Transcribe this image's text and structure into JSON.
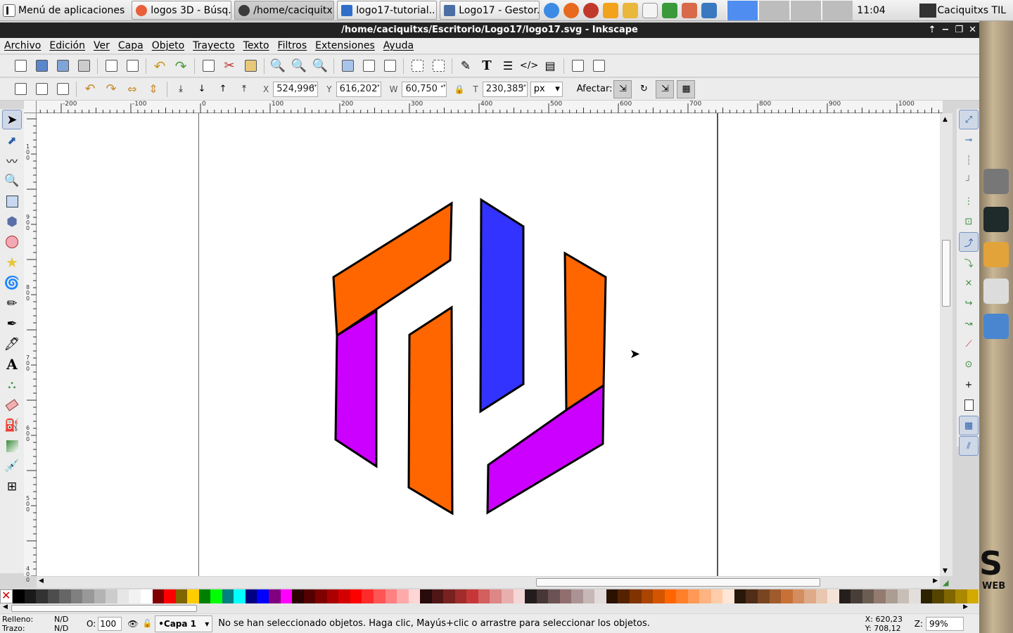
{
  "taskbar": {
    "app_menu": "Menú de aplicaciones",
    "tasks": [
      {
        "label": "logos 3D - Búsq...",
        "color": "#e8603a"
      },
      {
        "label": "/home/caciquitx...",
        "color": "#3a3a3a"
      },
      {
        "label": "logo17-tutorial....",
        "color": "#2f6fc9"
      },
      {
        "label": "Logo17 - Gestor...",
        "color": "#4a6fa5"
      }
    ],
    "launchers": [
      {
        "name": "chromium-icon",
        "color": "#3c8be4"
      },
      {
        "name": "firefox-icon",
        "color": "#e86a1e"
      },
      {
        "name": "pidgin-icon",
        "color": "#c0392b"
      },
      {
        "name": "hand-icon",
        "color": "#f2a21b"
      },
      {
        "name": "text-editor-icon",
        "color": "#e9b73c"
      },
      {
        "name": "document-icon",
        "color": "#f4f4f4"
      },
      {
        "name": "spreadsheet-icon",
        "color": "#3a9a3a"
      },
      {
        "name": "pdf-icon",
        "color": "#d86a4a"
      },
      {
        "name": "presentation-icon",
        "color": "#3a78c0"
      }
    ],
    "clock": "11:04",
    "user": "Caciquitxs TIL"
  },
  "window": {
    "title": "/home/caciquitxs/Escritorio/Logo17/logo17.svg - Inkscape"
  },
  "menu": [
    "Archivo",
    "Edición",
    "Ver",
    "Capa",
    "Objeto",
    "Trayecto",
    "Texto",
    "Filtros",
    "Extensiones",
    "Ayuda"
  ],
  "controls": {
    "x_label": "X",
    "x_value": "524,996",
    "y_label": "Y",
    "y_value": "616,202",
    "w_label": "W",
    "w_value": "60,750",
    "h_label": "T",
    "h_value": "230,385",
    "unit": "px",
    "afectar": "Afectar:"
  },
  "ruler": {
    "h_labels": [
      "-200",
      "-100",
      "0",
      "100",
      "200",
      "300",
      "400",
      "500",
      "600",
      "700",
      "800",
      "900",
      "1000"
    ],
    "v_labels": [
      "100",
      "900",
      "800",
      "700",
      "600",
      "500",
      "400"
    ]
  },
  "artwork": {
    "orange": "#ff6600",
    "purple": "#cc00ff",
    "blue": "#3333ff",
    "stroke": "#000000"
  },
  "palette": [
    "#000000",
    "#1a1a1a",
    "#333333",
    "#4d4d4d",
    "#666666",
    "#808080",
    "#999999",
    "#b3b3b3",
    "#cccccc",
    "#e6e6e6",
    "#f2f2f2",
    "#ffffff",
    "#800000",
    "#ff0000",
    "#806600",
    "#ffcc00",
    "#008000",
    "#00ff00",
    "#008080",
    "#00ffff",
    "#000080",
    "#0000ff",
    "#800080",
    "#ff00ff",
    "#2b0000",
    "#550000",
    "#800000",
    "#aa0000",
    "#d40000",
    "#ff0000",
    "#ff2a2a",
    "#ff5555",
    "#ff8080",
    "#ffaaaa",
    "#ffd5d5",
    "#280b0b",
    "#501616",
    "#782121",
    "#a02c2c",
    "#c83737",
    "#d35f5f",
    "#de8787",
    "#e9afaf",
    "#f4d7d7",
    "#241c1c",
    "#483737",
    "#6c5353",
    "#916f6f",
    "#ac9393",
    "#c8b7b7",
    "#e3dbdb",
    "#2b1100",
    "#552200",
    "#803300",
    "#aa4400",
    "#d45500",
    "#ff6600",
    "#ff7f2a",
    "#ff9955",
    "#ffb380",
    "#ffccaa",
    "#ffe6d5",
    "#28170b",
    "#502d16",
    "#784421",
    "#a05a2c",
    "#c87137",
    "#d38d5f",
    "#deaa87",
    "#e9c6af",
    "#f4e3d7",
    "#241f1c",
    "#483e37",
    "#6c5d53",
    "#917c6f",
    "#ac9d93",
    "#c8beb7",
    "#e3dedb",
    "#2b2200",
    "#554400",
    "#806600",
    "#aa8800",
    "#d4aa00"
  ],
  "status": {
    "fill_label": "Relleno:",
    "fill_value": "N/D",
    "stroke_label": "Trazo:",
    "stroke_value": "N/D",
    "opacity_label": "O:",
    "opacity_value": "100",
    "layer": "•Capa 1",
    "message": "No se han seleccionado objetos. Haga clic, Mayús+clic o arrastre para seleccionar los objetos.",
    "x_coord": "X: 620,23",
    "y_coord": "Y: 708,12",
    "zoom_label": "Z:",
    "zoom": "99%"
  },
  "desktop": {
    "overlay_letter": "S",
    "overlay_text": "WEB"
  }
}
